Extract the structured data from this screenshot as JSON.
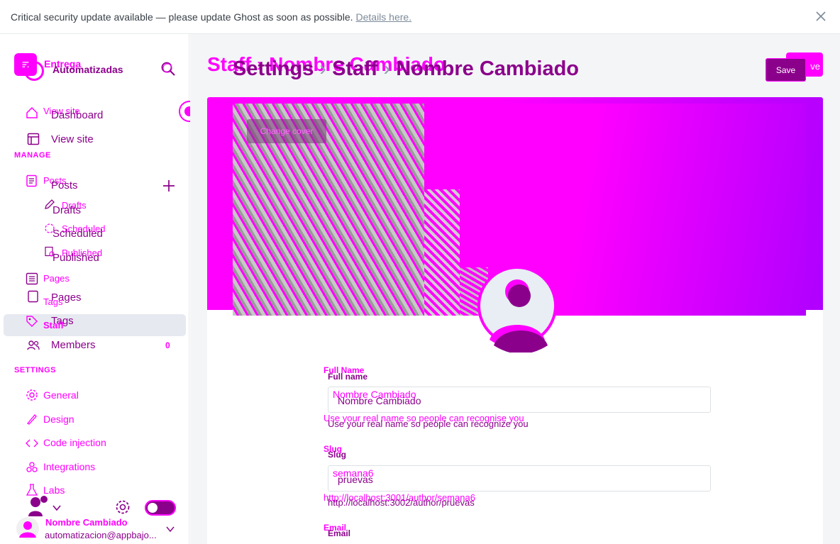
{
  "banner": {
    "text": "Critical security update available — please update Ghost as soon as possible.",
    "link": "Details here."
  },
  "site": {
    "name_a": "Entrega",
    "name_b": "Automatizadas"
  },
  "nav": {
    "view_site_ghost": "View site",
    "dashboard": "Dashboard",
    "view_site": "View site",
    "manage_label": "MANAGE",
    "posts_ghost": "Posts",
    "posts": "Posts",
    "drafts_ghost": "Drafts",
    "drafts": "Drafts",
    "scheduled_ghost": "Scheduled",
    "scheduled": "Scheduled",
    "published_ghost": "Published",
    "published": "Published",
    "pages_ghost": "Pages",
    "pages": "Pages",
    "tags_ghost": "Tags",
    "tags": "Tags",
    "staff": "Staff",
    "members": "Members",
    "members_count": "0",
    "settings_label": "SETTINGS",
    "general": "General",
    "design": "Design",
    "code_injection": "Code injection",
    "integrations": "Integrations",
    "labs": "Labs"
  },
  "user": {
    "name": "Nombre Cambiado",
    "email": "automatizacion@appbajo..."
  },
  "header": {
    "crumb_ghost": "Staff  ›  Nombre Cambiado",
    "crumb_settings": "Settings",
    "crumb_staff": "Staff",
    "crumb_user": "Nombre Cambiado",
    "sep": "›",
    "save_ghost": "ve",
    "save": "Save"
  },
  "profile": {
    "change_cover": "Change cover",
    "full_name_label_ghost": "Full Name",
    "full_name_label": "Full name",
    "full_name_ghost": "Nombre Cambiado",
    "full_name": "Nombre Cambiado",
    "full_name_hint_ghost": "Use your real name so people can recognise you",
    "full_name_hint": "Use your real name so people can recognize you",
    "slug_label_ghost": "Slug",
    "slug_label": "Slug",
    "slug_ghost": "semana6",
    "slug": "pruevas",
    "slug_url_ghost": "http://localhost:3001/author/semana6",
    "slug_url": "http://localhost:3002/author/pruevas",
    "email_label_ghost": "Email",
    "email_label": "Email"
  },
  "colors": {
    "accent": "#ff00ff",
    "accent_dark": "#8b008b",
    "panel": "#f4f5f7"
  }
}
